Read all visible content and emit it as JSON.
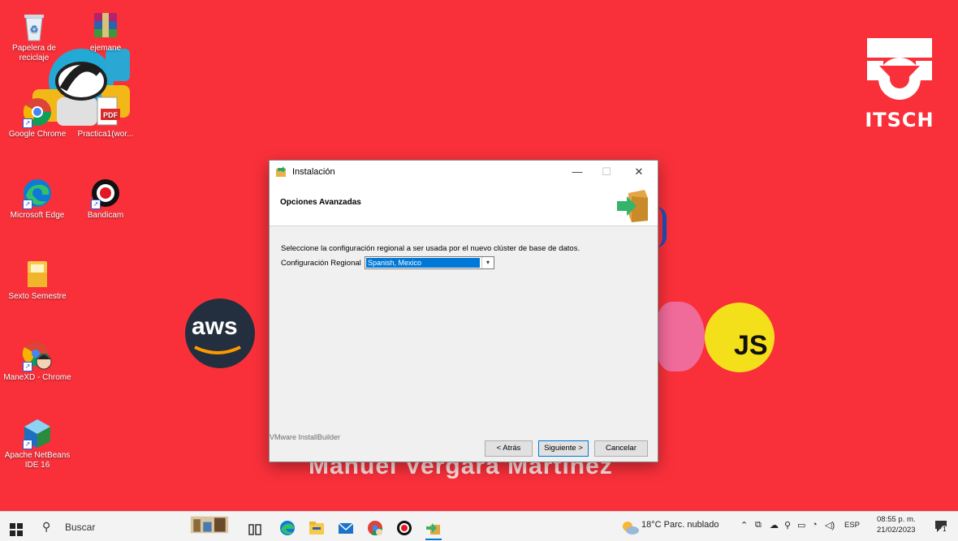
{
  "desktop": {
    "icons": [
      {
        "label": "Papelera de reciclaje"
      },
      {
        "label": "ejemane"
      },
      {
        "label": "Google Chrome"
      },
      {
        "label": "Practica1(wor..."
      },
      {
        "label": "Microsoft Edge"
      },
      {
        "label": "Bandicam"
      },
      {
        "label": "Sexto Semestre"
      },
      {
        "label": "ManeXD - Chrome"
      },
      {
        "label": "Apache NetBeans IDE 16"
      }
    ],
    "wallpaper": {
      "logo_text": "ITSCH",
      "aws_text": "aws",
      "js_text": "JS",
      "name_text": "Manuel Vergara Martinez",
      "color": "#f9303a"
    }
  },
  "dialog": {
    "title": "Instalación",
    "header": "Opciones Avanzadas",
    "description": "Seleccione la configuración regional a ser usada por el nuevo clúster de base de datos.",
    "locale_label": "Configuración Regional",
    "locale_value": "Spanish, Mexico",
    "brand": "VMware InstallBuilder",
    "back_label": "< Atrás",
    "next_label": "Siguiente >",
    "cancel_label": "Cancelar",
    "min_glyph": "—",
    "max_glyph": "☐",
    "close_glyph": "✕"
  },
  "taskbar": {
    "search_placeholder": "Buscar",
    "weather": "18°C  Parc. nublado",
    "language": "ESP",
    "time": "08:55 p. m.",
    "date": "21/02/2023",
    "notification_count": "1"
  }
}
